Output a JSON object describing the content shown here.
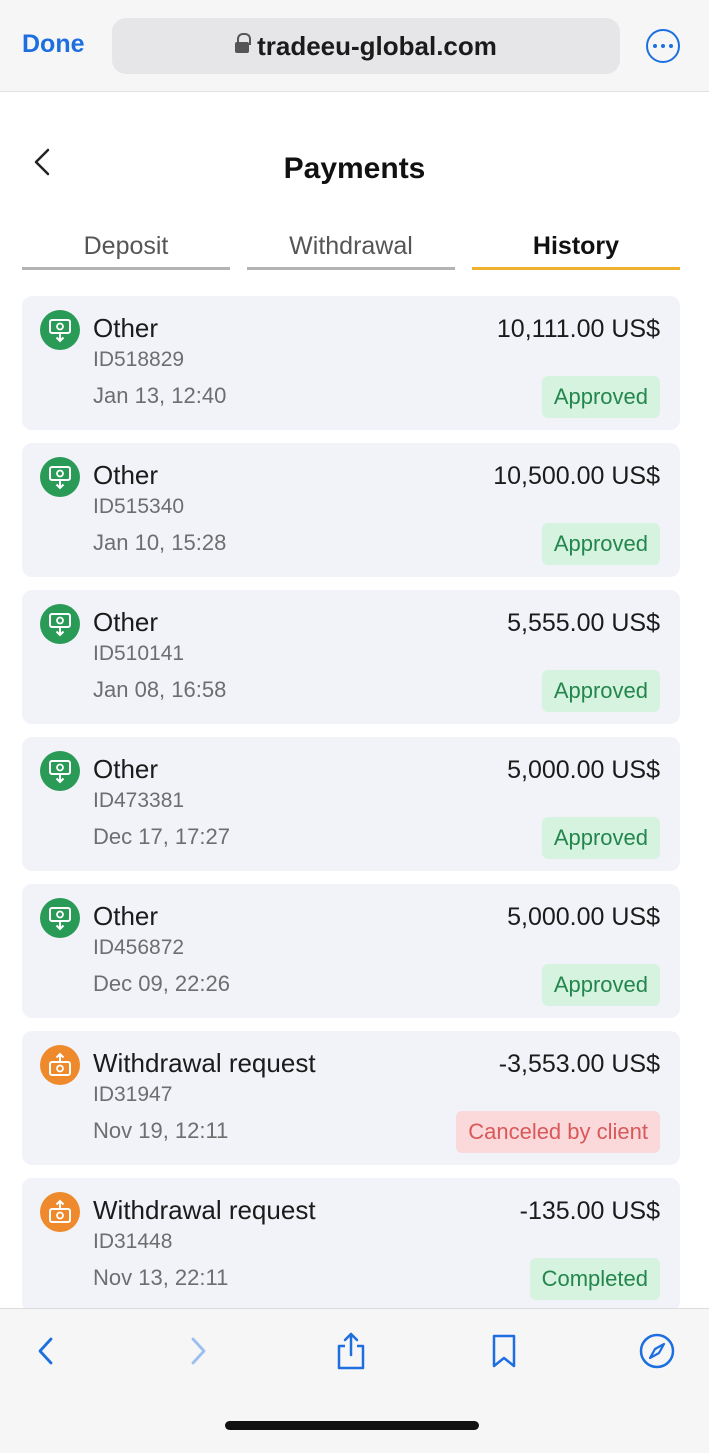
{
  "browser": {
    "done_label": "Done",
    "url": "tradeeu-global.com",
    "accent": "#1d6fe0"
  },
  "page": {
    "title": "Payments"
  },
  "tabs": [
    {
      "label": "Deposit",
      "active": false
    },
    {
      "label": "Withdrawal",
      "active": false
    },
    {
      "label": "History",
      "active": true
    }
  ],
  "transactions": [
    {
      "type": "Other",
      "id": "ID518829",
      "date": "Jan 13, 12:40",
      "amount": "10,111.00 US$",
      "status": "Approved",
      "icon": "deposit-icon"
    },
    {
      "type": "Other",
      "id": "ID515340",
      "date": "Jan 10, 15:28",
      "amount": "10,500.00 US$",
      "status": "Approved",
      "icon": "deposit-icon"
    },
    {
      "type": "Other",
      "id": "ID510141",
      "date": "Jan 08, 16:58",
      "amount": "5,555.00 US$",
      "status": "Approved",
      "icon": "deposit-icon"
    },
    {
      "type": "Other",
      "id": "ID473381",
      "date": "Dec 17, 17:27",
      "amount": "5,000.00 US$",
      "status": "Approved",
      "icon": "deposit-icon"
    },
    {
      "type": "Other",
      "id": "ID456872",
      "date": "Dec 09, 22:26",
      "amount": "5,000.00 US$",
      "status": "Approved",
      "icon": "deposit-icon"
    },
    {
      "type": "Withdrawal request",
      "id": "ID31947",
      "date": "Nov 19, 12:11",
      "amount": "-3,553.00 US$",
      "status": "Canceled by client",
      "icon": "withdrawal-icon"
    },
    {
      "type": "Withdrawal request",
      "id": "ID31448",
      "date": "Nov 13, 22:11",
      "amount": "-135.00 US$",
      "status": "Completed",
      "icon": "withdrawal-icon"
    }
  ],
  "colors": {
    "approved_bg": "#d6f3df",
    "approved_text": "#23864c",
    "canceled_bg": "#fbd9da",
    "canceled_text": "#d9585a",
    "deposit_icon": "#2a9a57",
    "withdrawal_icon": "#ee8a2c",
    "active_tab_underline": "#f0b030"
  },
  "toolbar": {
    "icons": [
      "back-icon",
      "forward-icon",
      "share-icon",
      "bookmarks-icon",
      "compass-icon"
    ]
  }
}
